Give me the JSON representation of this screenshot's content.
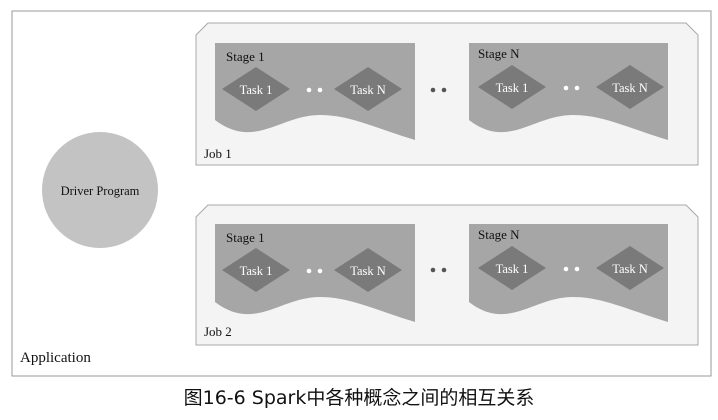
{
  "application": {
    "label": "Application"
  },
  "driver": {
    "label": "Driver Program"
  },
  "jobs": [
    {
      "label": "Job 1",
      "stages": [
        {
          "label": "Stage 1",
          "tasks": [
            "Task 1",
            "Task N"
          ]
        },
        {
          "label": "Stage N",
          "tasks": [
            "Task 1",
            "Task N"
          ]
        }
      ]
    },
    {
      "label": "Job 2",
      "stages": [
        {
          "label": "Stage 1",
          "tasks": [
            "Task 1",
            "Task N"
          ]
        },
        {
          "label": "Stage N",
          "tasks": [
            "Task 1",
            "Task N"
          ]
        }
      ]
    }
  ],
  "caption": "图16-6 Spark中各种概念之间的相互关系",
  "colors": {
    "application_border": "#9a9a9a",
    "job_fill": "#f4f4f4",
    "job_border": "#a8a8a8",
    "stage_fill": "#a6a6a6",
    "task_fill": "#7a7a7a",
    "task_text": "#ffffff",
    "driver_fill": "#c3c3c3",
    "dot_fill": "#ffffff",
    "between_dot_fill": "#555555",
    "text": "#111111"
  }
}
